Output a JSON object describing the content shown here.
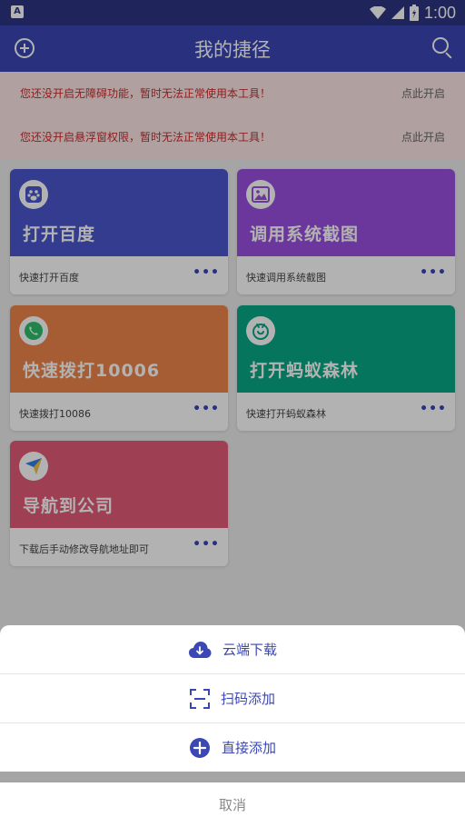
{
  "status_bar": {
    "time": "1:00",
    "badge": "A"
  },
  "app_bar": {
    "title": "我的捷径"
  },
  "warnings": [
    {
      "text": "您还没开启无障碍功能，暂时无法正常使用本工具！",
      "action": "点此开启"
    },
    {
      "text": "您还没开启悬浮窗权限，暂时无法正常使用本工具！",
      "action": "点此开启"
    }
  ],
  "cards": [
    {
      "title": "打开百度",
      "desc": "快速打开百度",
      "more": "•••",
      "icon": "baidu-paw-icon",
      "color": "#4a56cc"
    },
    {
      "title": "调用系统截图",
      "desc": "快速调用系统截图",
      "more": "•••",
      "icon": "image-icon",
      "color": "#9b4fe0"
    },
    {
      "title": "快速拨打10006",
      "desc": "快速拨打10086",
      "more": "•••",
      "icon": "phone-icon",
      "color": "#f0864a"
    },
    {
      "title": "打开蚂蚁森林",
      "desc": "快速打开蚂蚁森林",
      "more": "•••",
      "icon": "ant-icon",
      "color": "#0aa886"
    },
    {
      "title": "导航到公司",
      "desc": "下载后手动修改导航地址即可",
      "more": "•••",
      "icon": "navigation-icon",
      "color": "#e35b77"
    }
  ],
  "sheet": {
    "options": [
      {
        "label": "云端下载",
        "icon": "cloud-download-icon"
      },
      {
        "label": "扫码添加",
        "icon": "scan-icon"
      },
      {
        "label": "直接添加",
        "icon": "add-circle-icon"
      }
    ],
    "cancel": "取消"
  },
  "colors": {
    "primary": "#3b47b5",
    "status_bar": "#2d3582",
    "warning_text": "#cc2c2c"
  }
}
